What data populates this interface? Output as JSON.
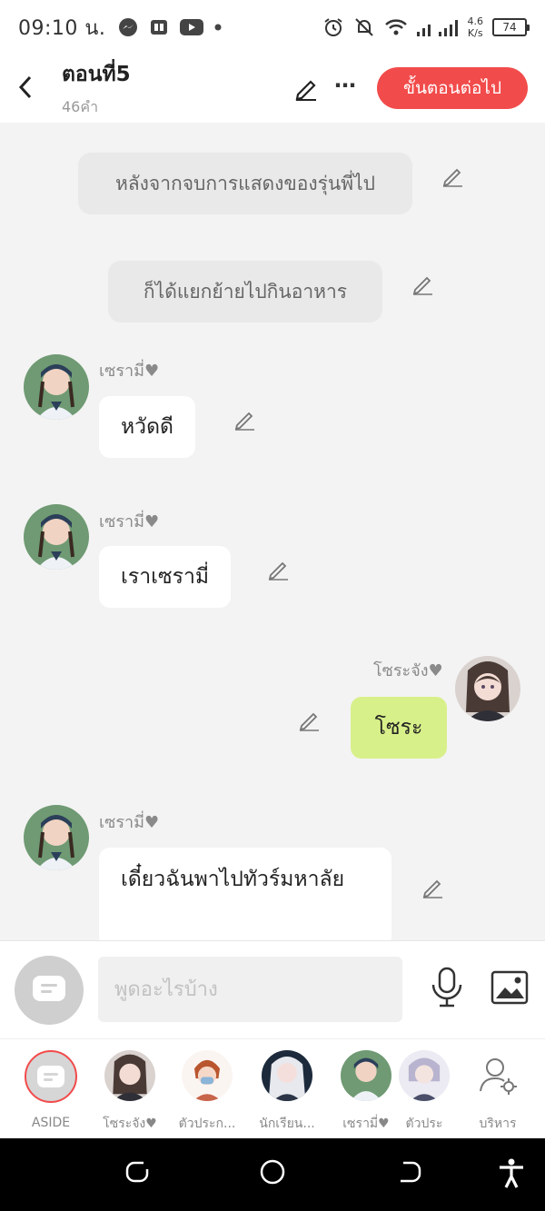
{
  "status": {
    "time": "09:10 น.",
    "speed_top": "4.6",
    "speed_bottom": "K/s",
    "battery": "74"
  },
  "header": {
    "title": "ตอนที่5",
    "word_count": "46คำ",
    "next_label": "ขั้นตอนต่อไป"
  },
  "messages": {
    "narration1": "หลังจากจบการแสดงของรุ่นพี่ไป",
    "narration2": "ก็ได้แยกย้ายไปกินอาหาร",
    "m1": {
      "sender": "เซรามี่♥",
      "text": "หวัดดี"
    },
    "m2": {
      "sender": "เซรามี่♥",
      "text": "เราเซรามี่"
    },
    "m3": {
      "sender": "โซระจัง♥",
      "text": "โซระ"
    },
    "m4": {
      "sender": "เซรามี่♥",
      "text": "เดี๋ยวฉันพาไปทัวร์มหาลัย"
    }
  },
  "input": {
    "placeholder": "พูดอะไรบ้าง"
  },
  "characters": {
    "aside": "ASIDE",
    "c1": "โซระจัง♥",
    "c2": "ตัวประก...",
    "c3": "นักเรียน...",
    "c4": "เซรามี่♥",
    "c5": "ตัวประ",
    "manage": "บริหาร"
  },
  "colors": {
    "accent": "#f24b4b",
    "my_bubble": "#d8f08a",
    "narration_bg": "#e9e9e9"
  },
  "icons": [
    "messenger-icon",
    "app-icon",
    "youtube-icon",
    "alarm-icon",
    "mute-icon",
    "wifi-icon",
    "signal-icon",
    "battery-icon",
    "back-icon",
    "edit-icon",
    "more-icon",
    "mic-icon",
    "image-icon",
    "manage-icon"
  ]
}
